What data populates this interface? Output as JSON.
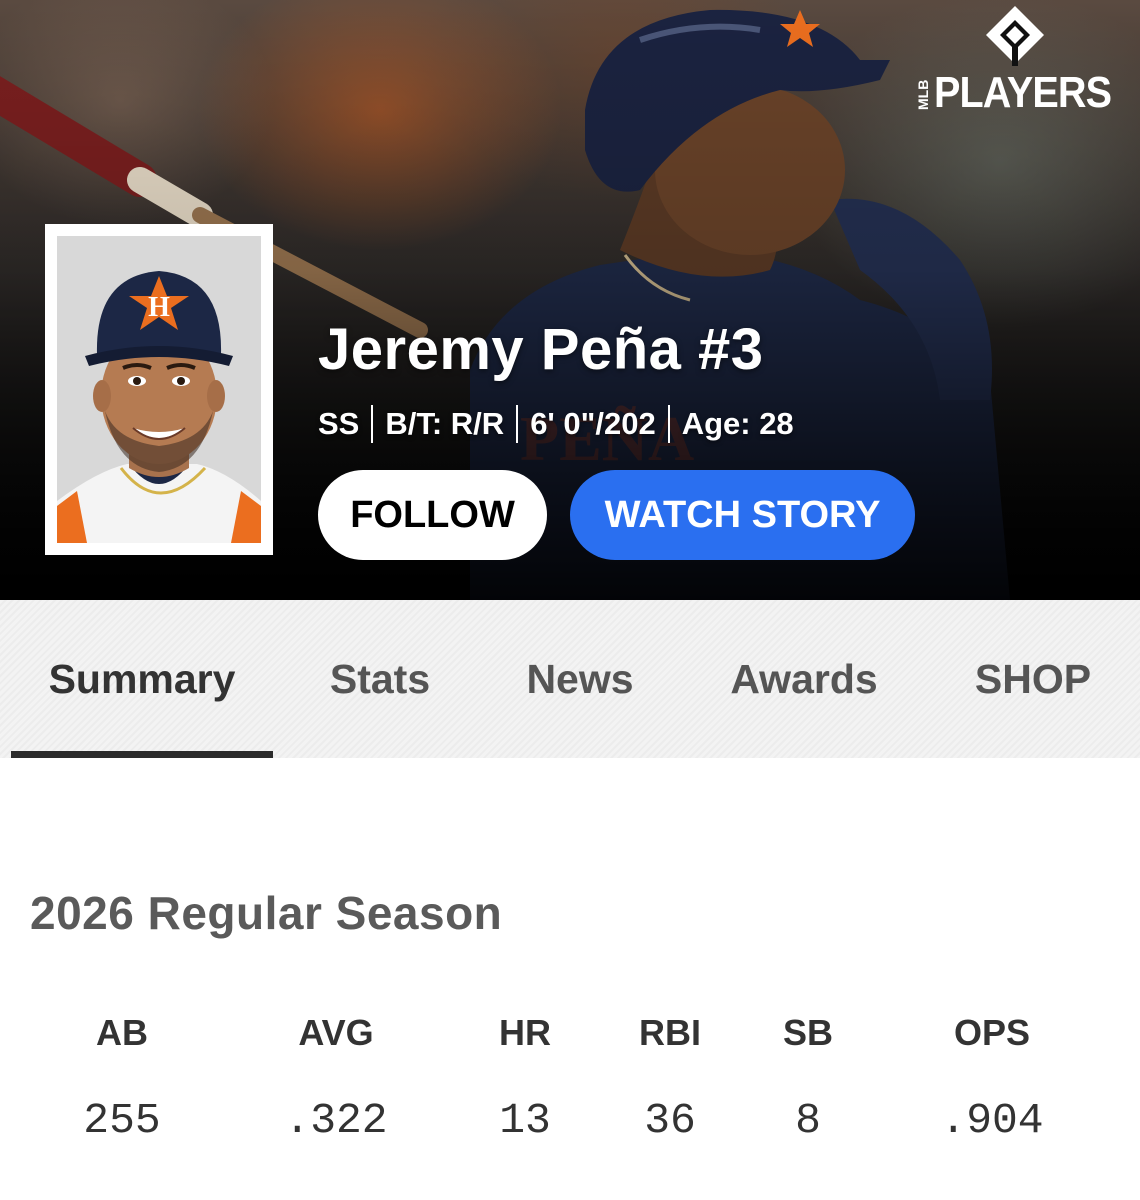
{
  "brand": {
    "logo_small": "MLB",
    "logo_text": "PLAYERS"
  },
  "player": {
    "name": "Jeremy Peña #3",
    "position": "SS",
    "bats_throws": "B/T: R/R",
    "height_weight": "6' 0\"/202",
    "age": "Age: 28"
  },
  "actions": {
    "follow_label": "FOLLOW",
    "watch_label": "WATCH STORY"
  },
  "tabs": [
    {
      "label": "Summary",
      "active": true
    },
    {
      "label": "Stats",
      "active": false
    },
    {
      "label": "News",
      "active": false
    },
    {
      "label": "Awards",
      "active": false
    },
    {
      "label": "SHOP",
      "active": false
    }
  ],
  "season": {
    "title": "2026 Regular Season",
    "stats": [
      {
        "label": "AB",
        "value": "255"
      },
      {
        "label": "AVG",
        "value": ".322"
      },
      {
        "label": "HR",
        "value": "13"
      },
      {
        "label": "RBI",
        "value": "36"
      },
      {
        "label": "SB",
        "value": "8"
      },
      {
        "label": "OPS",
        "value": ".904"
      }
    ]
  },
  "colors": {
    "accent_blue": "#2a6ff0",
    "team_navy": "#1c2745",
    "team_orange": "#eb6e1f"
  },
  "icons": {
    "logo_mark": "mlb-players-diamond-icon"
  }
}
